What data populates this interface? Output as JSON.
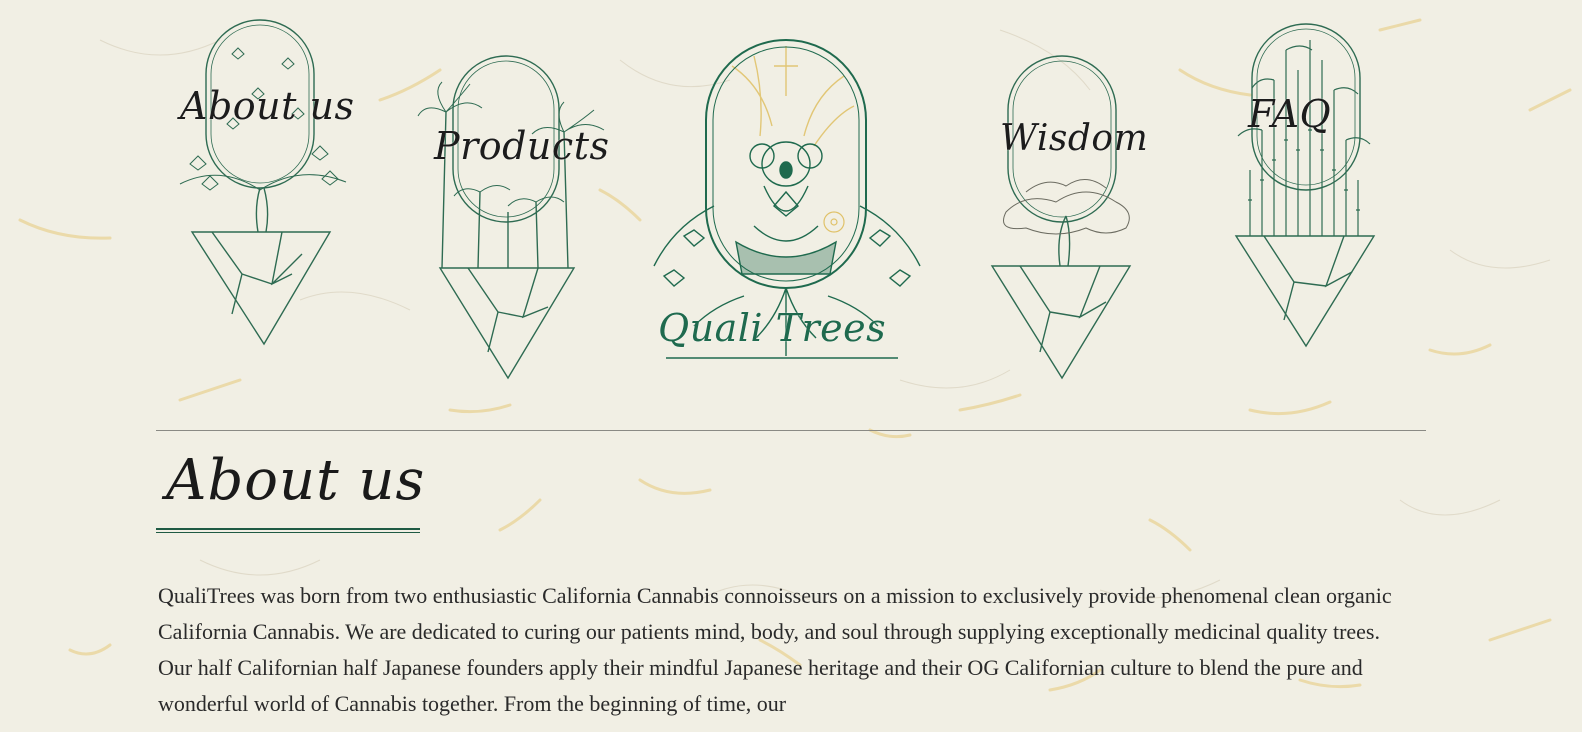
{
  "nav": {
    "items": [
      {
        "label": "About us"
      },
      {
        "label": "Products"
      },
      {
        "label": "Wisdom"
      },
      {
        "label": "FAQ"
      }
    ],
    "logo": {
      "text": "Quali Trees"
    }
  },
  "about": {
    "title": "About us",
    "body": "QualiTrees was born from two enthusiastic California Cannabis connoisseurs on a mission to exclusively provide phenomenal clean organic California Cannabis. We are dedicated to curing our patients mind, body, and soul through supplying exceptionally medicinal quality trees. Our half Californian half Japanese founders apply their mindful Japanese heritage and their OG Californian culture to blend the pure and wonderful world of Cannabis together. From the beginning of time, our"
  },
  "colors": {
    "background": "#f1efe4",
    "accent_green": "#1f5a43",
    "fiber_gold": "#e3c06a"
  },
  "icons": [
    "maple-tree-icon",
    "palm-tree-icon",
    "koala-logo-icon",
    "bonsai-tree-icon",
    "bamboo-icon"
  ]
}
